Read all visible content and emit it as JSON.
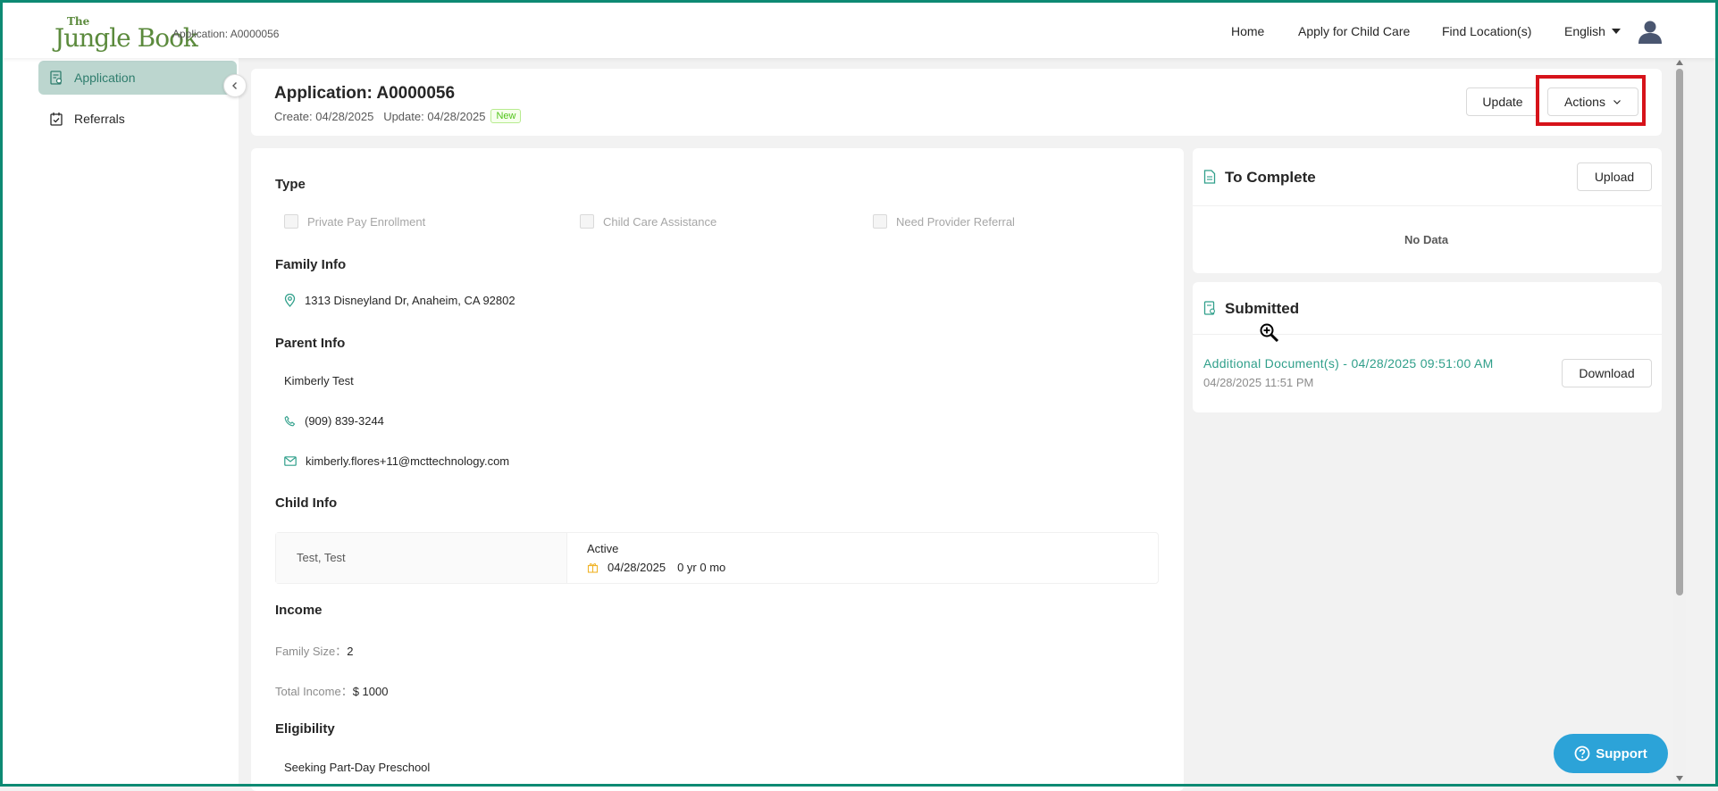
{
  "header": {
    "logo_the": "The",
    "logo_name": "Jungle Book",
    "app_ref": "Application: A0000056",
    "nav": {
      "home": "Home",
      "apply": "Apply for Child Care",
      "find": "Find Location(s)",
      "language": "English"
    }
  },
  "sidebar": {
    "items": [
      {
        "label": "Application",
        "icon": "application-icon"
      },
      {
        "label": "Referrals",
        "icon": "referrals-icon"
      }
    ]
  },
  "app_header": {
    "title": "Application: A0000056",
    "create_label": "Create:",
    "create_date": "04/28/2025",
    "update_label": "Update:",
    "update_date": "04/28/2025",
    "status": "New",
    "update_button": "Update",
    "actions_button": "Actions"
  },
  "details": {
    "type_title": "Type",
    "type_options": [
      "Private Pay Enrollment",
      "Child Care Assistance",
      "Need Provider Referral"
    ],
    "family_title": "Family Info",
    "address": "1313 Disneyland Dr, Anaheim, CA 92802",
    "parent_title": "Parent Info",
    "parent_name": "Kimberly Test",
    "phone": "(909) 839-3244",
    "email": "kimberly.flores+11@mcttechnology.com",
    "child_title": "Child Info",
    "child_name": "Test, Test",
    "child_status": "Active",
    "child_dob": "04/28/2025",
    "child_age": "0 yr 0 mo",
    "income_title": "Income",
    "family_size_label": "Family Size：",
    "family_size": "2",
    "total_income_label": "Total Income：",
    "total_income": "$ 1000",
    "eligibility_title": "Eligibility",
    "eligibility_value": "Seeking Part-Day Preschool"
  },
  "to_complete": {
    "title": "To Complete",
    "upload_button": "Upload",
    "empty": "No Data"
  },
  "submitted": {
    "title": "Submitted",
    "doc_name": "Additional Document(s) - 04/28/2025 09:51:00 AM",
    "doc_time": "04/28/2025 11:51 PM",
    "download_button": "Download"
  },
  "support": {
    "label": "Support"
  },
  "colors": {
    "accent": "#2f9f8a",
    "highlight": "#d6131a",
    "support": "#2ca3d8",
    "logo": "#5b8a3c"
  }
}
